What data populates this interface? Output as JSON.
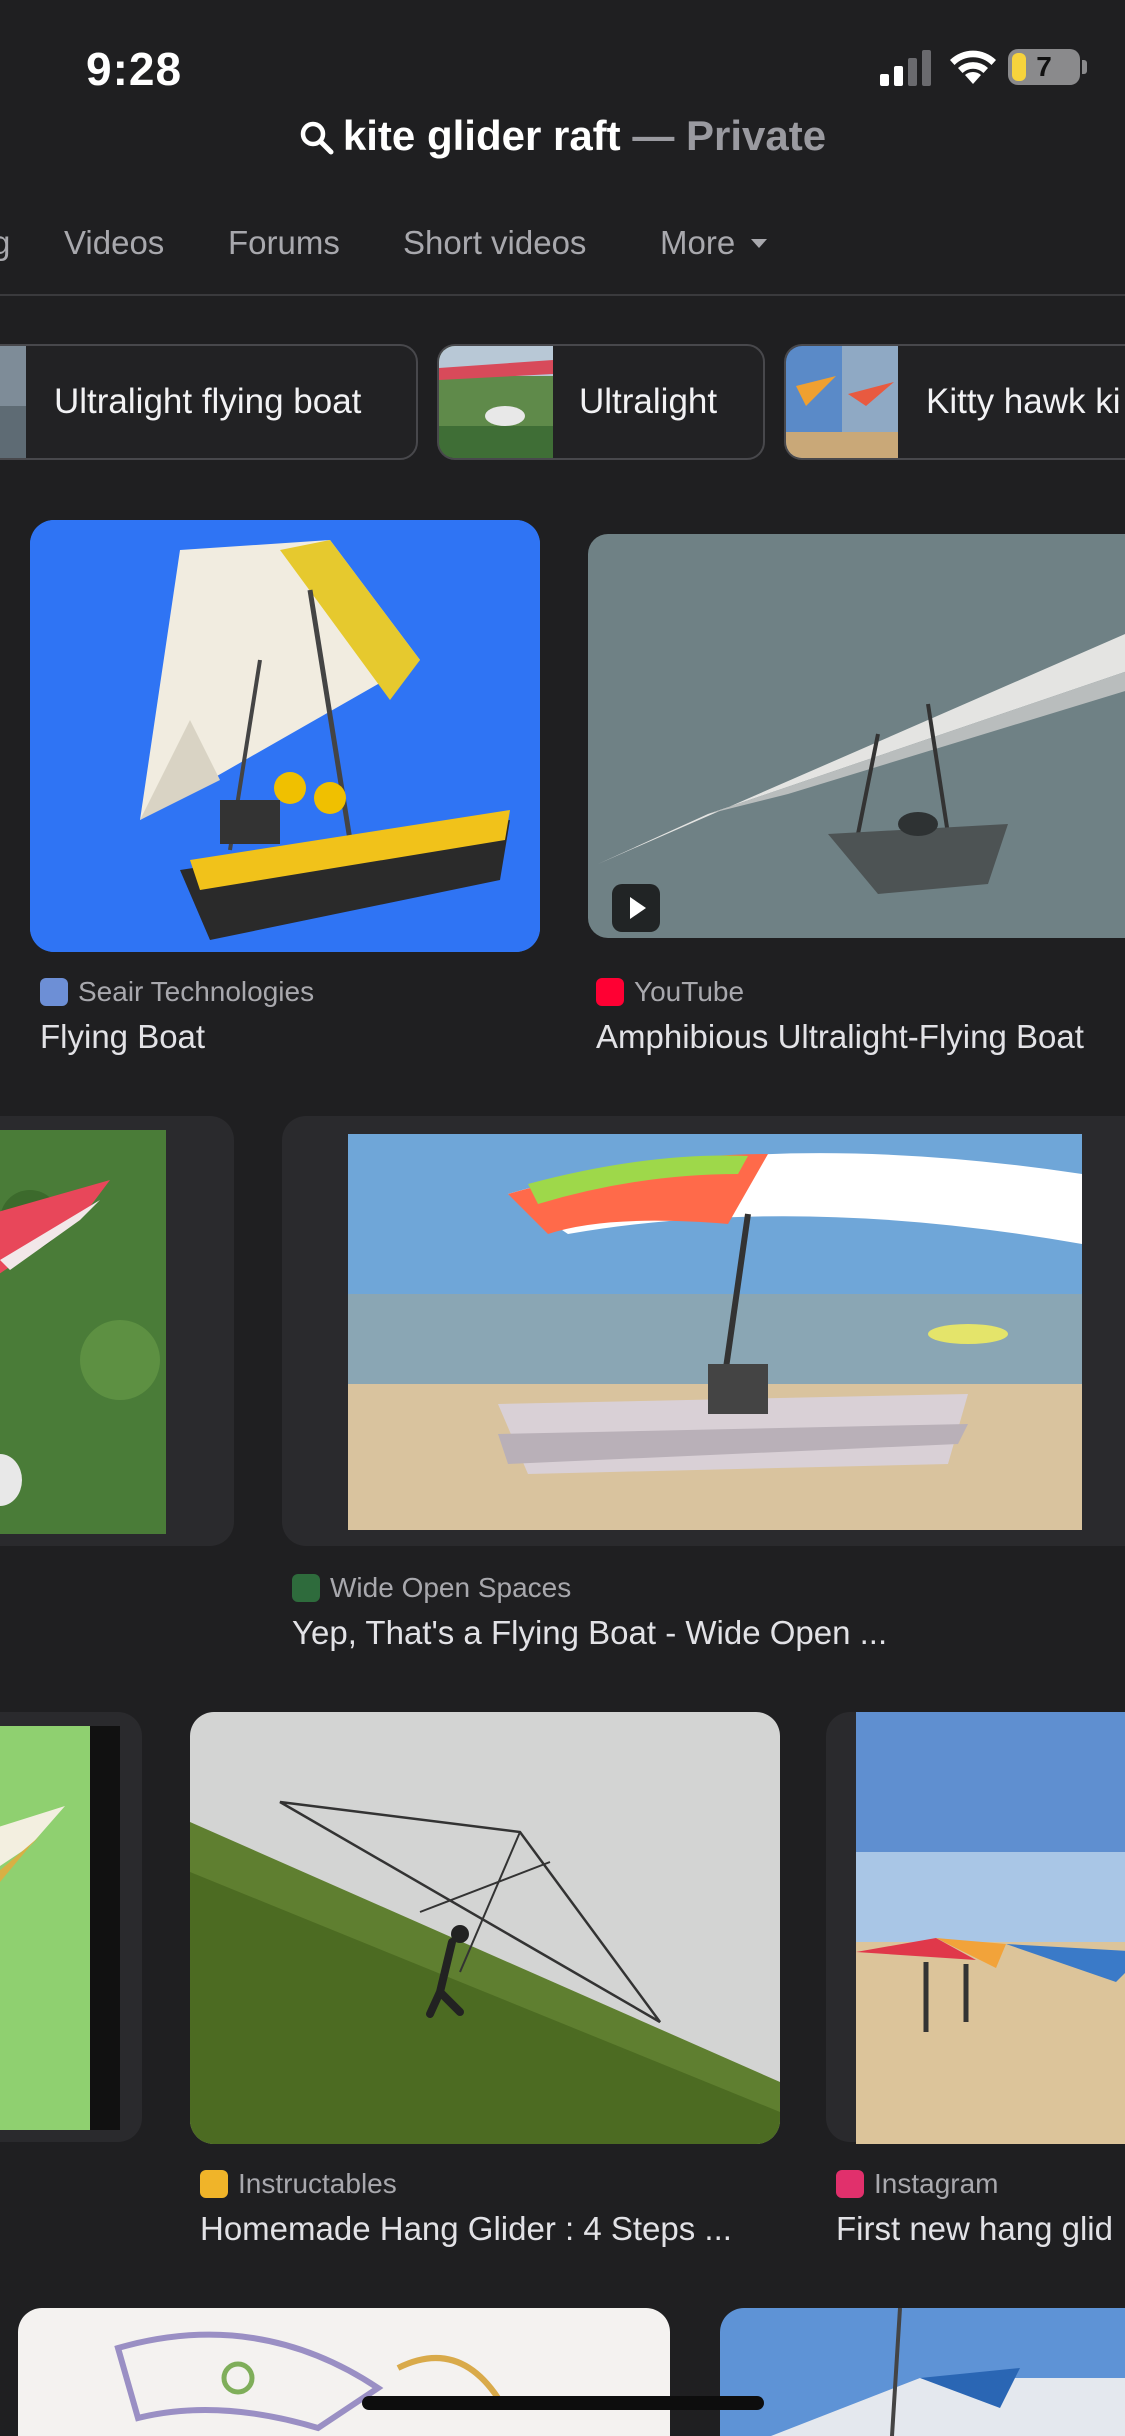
{
  "status_bar": {
    "time": "9:28",
    "battery": "7"
  },
  "search": {
    "query": "kite glider raft",
    "separator": "—",
    "mode": "Private"
  },
  "tabs": [
    {
      "label": "g"
    },
    {
      "label": "Videos"
    },
    {
      "label": "Forums"
    },
    {
      "label": "Short videos"
    },
    {
      "label": "More"
    }
  ],
  "chips": [
    {
      "label": "Ultralight flying boat"
    },
    {
      "label": "Ultralight"
    },
    {
      "label": "Kitty hawk ki"
    }
  ],
  "results": [
    {
      "source": "Seair Technologies",
      "title": "Flying Boat"
    },
    {
      "source": "YouTube",
      "title": "Amphibious Ultralight-Flying Boat"
    },
    {
      "source": "Wide Open Spaces",
      "title": "Yep, That's a Flying Boat - Wide Open ..."
    },
    {
      "source": "Instructables",
      "title": "Homemade Hang Glider : 4 Steps ..."
    },
    {
      "source": "Instagram",
      "title": "First new hang glid"
    }
  ],
  "colors": {
    "background": "#1f1f21",
    "youtube": "#ff0033",
    "instagram": "#e1306c"
  }
}
